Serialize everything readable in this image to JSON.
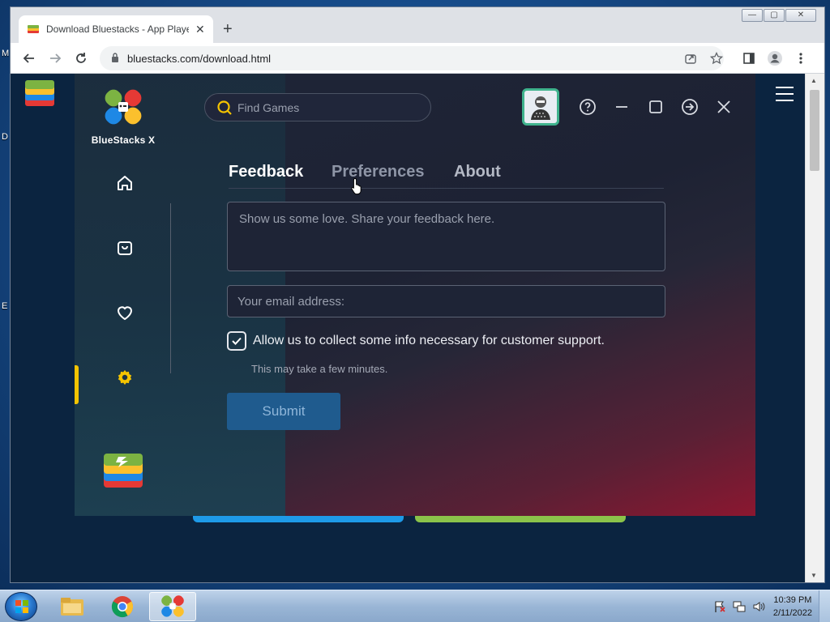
{
  "browser": {
    "tab_title": "Download Bluestacks - App Player",
    "tab_close": "✕",
    "new_tab": "+",
    "url": "bluestacks.com/download.html",
    "window_buttons": [
      "—",
      "▢",
      "✕"
    ]
  },
  "desktop": {
    "fragments": [
      "M",
      "D",
      "E"
    ]
  },
  "app": {
    "brand_name": "BlueStacks X",
    "search_placeholder": "Find Games",
    "nav": [
      "home-icon",
      "store-icon",
      "heart-icon",
      "gear-icon"
    ],
    "active_nav": "gear-icon",
    "tabs": [
      {
        "label": "Feedback",
        "active": true
      },
      {
        "label": "Preferences",
        "active": false
      },
      {
        "label": "About",
        "active": false
      }
    ],
    "feedback_placeholder": "Show us some love. Share your feedback here.",
    "email_placeholder": "Your email address:",
    "consent_label": "Allow us to collect some info necessary for customer support.",
    "consent_checked": true,
    "note": "This may take a few minutes.",
    "submit_label": "Submit"
  },
  "taskbar": {
    "time": "10:39 PM",
    "date": "2/11/2022"
  },
  "colors": {
    "accent": "#f5c400",
    "submit_bg": "#1f5b8e",
    "active_tab": "#ffffff",
    "inactive_tab": "#8e95a6"
  }
}
